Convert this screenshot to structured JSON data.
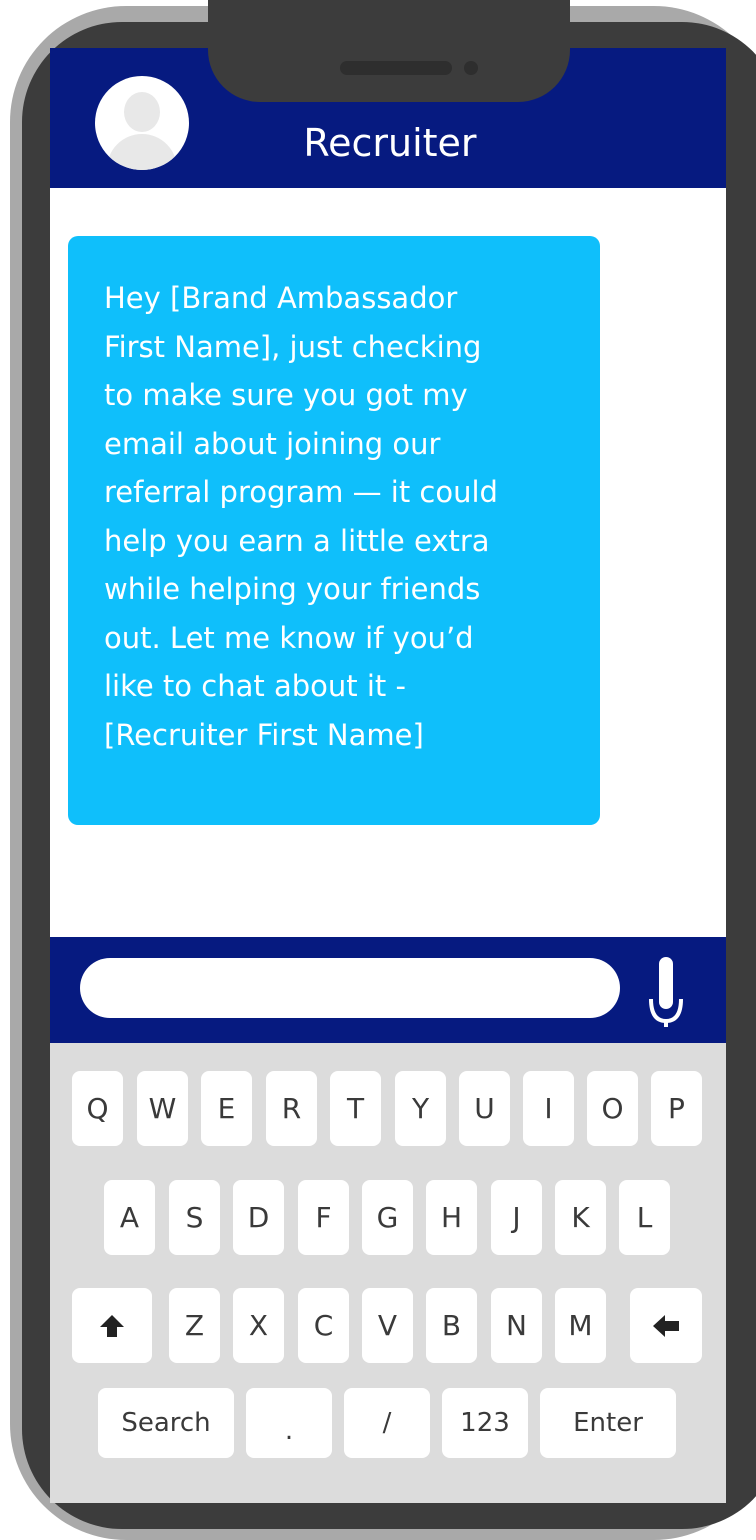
{
  "header": {
    "title": "Recruiter",
    "avatar_icon": "user-avatar-icon"
  },
  "message": {
    "text": "Hey [Brand Ambassador\nFirst Name], just checking\nto make sure you got my\nemail about joining our\nreferral program — it could\nhelp you earn a little extra\nwhile helping your friends\nout. Let me know if you’d\nlike to chat about it -\n[Recruiter First Name]"
  },
  "composer": {
    "value": "",
    "mic_icon": "microphone-icon"
  },
  "keyboard": {
    "row1": [
      "Q",
      "W",
      "E",
      "R",
      "T",
      "Y",
      "U",
      "I",
      "O",
      "P"
    ],
    "row2": [
      "A",
      "S",
      "D",
      "F",
      "G",
      "H",
      "J",
      "K",
      "L"
    ],
    "row3": [
      "Z",
      "X",
      "C",
      "V",
      "B",
      "N",
      "M"
    ],
    "shift_icon": "shift-arrow-up-icon",
    "backspace_icon": "backspace-arrow-left-icon",
    "bottom": [
      "Search",
      ".",
      "/",
      "123",
      "Enter"
    ]
  },
  "colors": {
    "header_bg": "#061a80",
    "bubble_bg": "#0fbffb",
    "keyboard_bg": "#dcdcdc",
    "phone_frame": "#3c3c3c",
    "phone_outer": "#a9a9a9"
  }
}
